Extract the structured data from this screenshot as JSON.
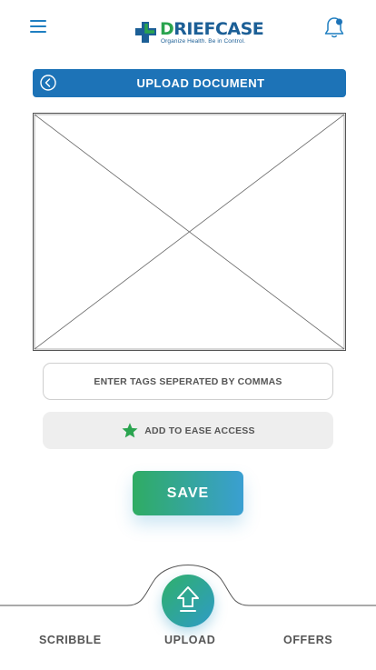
{
  "header": {
    "menu_icon": "hamburger-menu-icon",
    "logo": {
      "mark": "D",
      "text_rest": "RIEFCASE",
      "tagline": "Organize Health. Be in Control."
    },
    "notification_icon": "bell-icon"
  },
  "title_bar": {
    "title": "UPLOAD DOCUMENT",
    "back_icon": "chevron-left-circle-icon",
    "color": "#1d73b7"
  },
  "placeholder": {
    "icon": "image-placeholder"
  },
  "tags": {
    "placeholder": "ENTER TAGS SEPERATED BY COMMAS"
  },
  "ease_access": {
    "label": "ADD TO EASE ACCESS",
    "icon": "star-icon",
    "star_color": "#2aa44f"
  },
  "save": {
    "label": "SAVE"
  },
  "bottom_nav": {
    "items": [
      {
        "label": "SCRIBBLE"
      },
      {
        "label": "UPLOAD",
        "icon": "upload-arrow-icon"
      },
      {
        "label": "OFFERS"
      }
    ]
  }
}
